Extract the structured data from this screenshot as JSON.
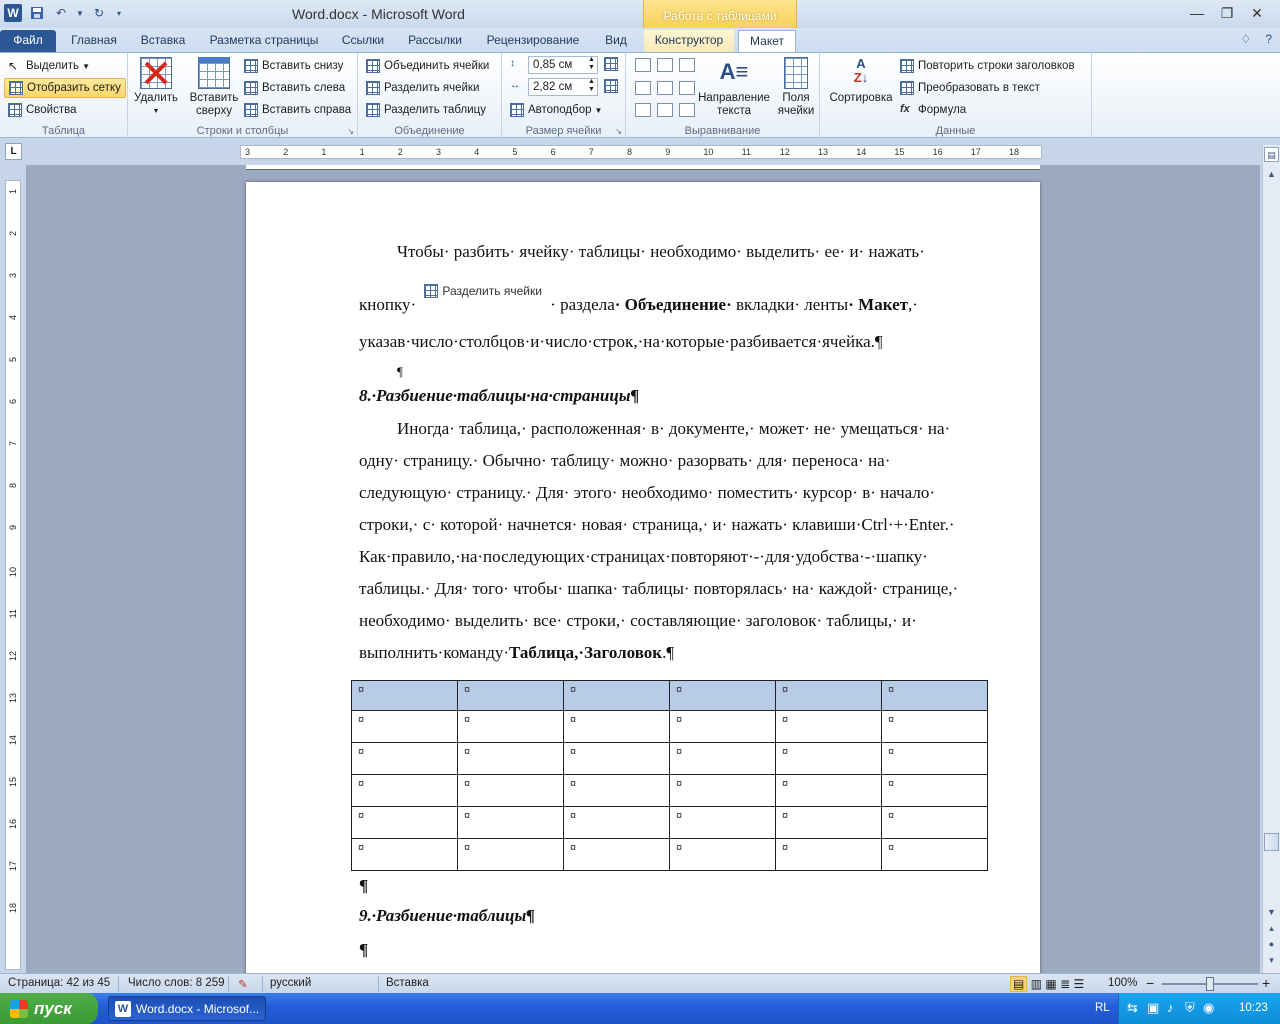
{
  "window": {
    "title": "Word.docx  -  Microsoft Word",
    "context_tab_title": "Работа с таблицами",
    "controls": [
      "—",
      "❐",
      "✕"
    ]
  },
  "tabs": {
    "file": "Файл",
    "home": "Главная",
    "insert": "Вставка",
    "page_layout": "Разметка страницы",
    "references": "Ссылки",
    "mailings": "Рассылки",
    "review": "Рецензирование",
    "view": "Вид",
    "design": "Конструктор",
    "layout": "Макет",
    "right_icons": [
      "♢",
      "?"
    ]
  },
  "ribbon": {
    "table": {
      "label": "Таблица",
      "select": "Выделить",
      "show_grid": "Отобразить сетку",
      "properties": "Свойства"
    },
    "rows_cols": {
      "label": "Строки и столбцы",
      "delete": "Удалить",
      "insert_above_1": "Вставить",
      "insert_above_2": "сверху",
      "insert_below": "Вставить снизу",
      "insert_left": "Вставить слева",
      "insert_right": "Вставить справа"
    },
    "merge": {
      "label": "Объединение",
      "merge_cells": "Объединить ячейки",
      "split_cells": "Разделить ячейки",
      "split_table": "Разделить таблицу"
    },
    "cell_size": {
      "label": "Размер ячейки",
      "height": "0,85 см",
      "width": "2,82 см",
      "autofit": "Автоподбор"
    },
    "alignment": {
      "label": "Выравнивание",
      "text_dir_1": "Направление",
      "text_dir_2": "текста",
      "margins_1": "Поля",
      "margins_2": "ячейки"
    },
    "data": {
      "label": "Данные",
      "sort": "Сортировка",
      "repeat_headers": "Повторить строки заголовков",
      "convert": "Преобразовать в текст",
      "formula": "Формула"
    }
  },
  "ruler": {
    "h_ticks": [
      "3",
      "2",
      "1",
      "1",
      "2",
      "3",
      "4",
      "5",
      "6",
      "7",
      "8",
      "9",
      "10",
      "11",
      "12",
      "13",
      "14",
      "15",
      "16",
      "17",
      "18"
    ],
    "v_ticks": [
      "1",
      "2",
      "3",
      "4",
      "5",
      "6",
      "7",
      "8",
      "9",
      "10",
      "11",
      "12",
      "13",
      "14",
      "15",
      "16",
      "17",
      "18"
    ],
    "corner": "L"
  },
  "document": {
    "p1_line1": "Чтобы· разбить· ячейку· таблицы· необходимо· выделить· ее· и· нажать·",
    "p1_line2_a": "кнопку·",
    "p1_inline_button": "Разделить ячейки",
    "p1_line2_b": "· раздела",
    "p1_line2_bold1": "· Объединение·",
    "p1_line2_c": " вкладки· ленты",
    "p1_line2_bold2": "· Макет",
    "p1_line2_d": ",·",
    "p1_line3": "указав·число·столбцов·и·число·строк,·на·которые·разбивается·ячейка.¶",
    "empty_para": "¶",
    "heading8": "8.·Разбиение·таблицы·на·страницы¶",
    "p2_lines": [
      "Иногда· таблица,· расположенная· в· документе,· может· не· умещаться· на·",
      "одну· страницу.· Обычно· таблицу· можно· разорвать· для· переноса· на·",
      "следующую· страницу.· Для· этого· необходимо· поместить· курсор· в· начало·",
      "строки,· с· которой· начнется· новая· страница,· и· нажать· клавиши·Ctrl·+·Enter.·",
      "Как·правило,·на·последующих·страницах·повторяют·-·для·удобства·-·шапку·",
      "таблицы.· Для· того· чтобы· шапка· таблицы· повторялась· на· каждой· странице,·",
      "необходимо· выделить· все· строки,· составляющие· заголовок· таблицы,· и·"
    ],
    "p2_last_a": "выполнить·команду·",
    "p2_last_bold": "Таблица,·Заголовок",
    "p2_last_b": ".¶",
    "table_cell_mark": "¤",
    "table_rows": 6,
    "table_cols": 6,
    "after_table": "¶",
    "heading9": "9.·Разбиение·таблицы¶",
    "final_para": "¶"
  },
  "statusbar": {
    "page": "Страница: 42 из 45",
    "words": "Число слов: 8 259",
    "language": "русский",
    "mode": "Вставка",
    "zoom": "100%",
    "zoom_minus": "−",
    "zoom_plus": "+"
  },
  "taskbar": {
    "start": "пуск",
    "word_task": "Word.docx - Microsof...",
    "lang": "RL",
    "time": "10:23"
  },
  "colors": {
    "accent": "#2b5797",
    "context_tab": "#f6d25a",
    "header_row": "#b8cce8"
  }
}
